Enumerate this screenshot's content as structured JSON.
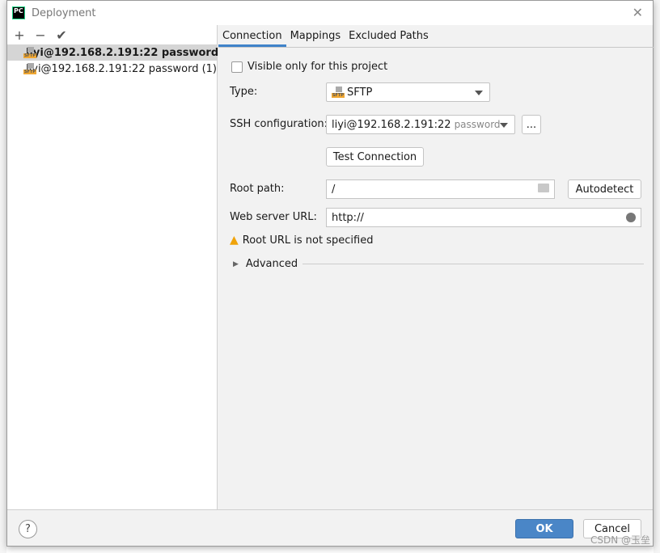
{
  "window": {
    "title": "Deployment",
    "close_icon": "close-icon"
  },
  "toolbar": {
    "add": "+",
    "remove": "−",
    "apply": "✔"
  },
  "servers": [
    {
      "label": "liyi@192.168.2.191:22 password",
      "selected": true
    },
    {
      "label": "liyi@192.168.2.191:22 password (1)",
      "selected": false
    }
  ],
  "tabs": [
    {
      "label": "Connection",
      "active": true
    },
    {
      "label": "Mappings"
    },
    {
      "label": "Excluded Paths"
    }
  ],
  "form": {
    "visible_only": {
      "label": "Visible only for this project",
      "checked": false
    },
    "type": {
      "label": "Type:",
      "value": "SFTP"
    },
    "ssh": {
      "label": "SSH configuration:",
      "value": "liyi@192.168.2.191:22",
      "hint": "password",
      "more": "..."
    },
    "test_connection": "Test Connection",
    "root_path": {
      "label": "Root path:",
      "value": "/"
    },
    "autodetect": "Autodetect",
    "web_url": {
      "label": "Web server URL:",
      "value": "http://"
    },
    "warning": "Root URL is not specified",
    "advanced": "Advanced"
  },
  "footer": {
    "help": "?",
    "ok": "OK",
    "cancel": "Cancel"
  },
  "watermark": "CSDN @玉垒",
  "colors": {
    "accent": "#4083c9",
    "ok_button": "#4a86c7",
    "warning": "#f0a30a"
  }
}
